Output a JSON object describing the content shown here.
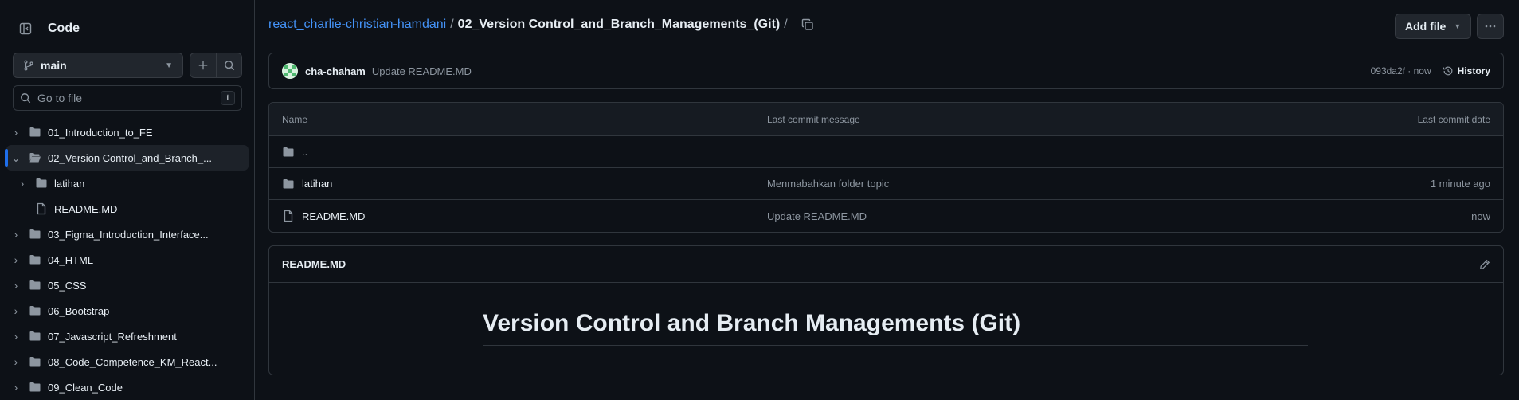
{
  "colors": {
    "background": "#0d1117",
    "border": "#30363d",
    "link": "#4493f8",
    "muted": "#8d96a0",
    "active_indicator": "#1f6feb",
    "top_accent": "#f78166"
  },
  "sidebar": {
    "title": "Code",
    "branch": "main",
    "goto_placeholder": "Go to file",
    "goto_shortcut": "t",
    "items": [
      {
        "label": "01_Introduction_to_FE",
        "type": "folder",
        "expanded": false,
        "depth": 0
      },
      {
        "label": "02_Version Control_and_Branch_...",
        "type": "folder",
        "expanded": true,
        "depth": 0,
        "active": true
      },
      {
        "label": "latihan",
        "type": "folder",
        "expanded": false,
        "depth": 1
      },
      {
        "label": "README.MD",
        "type": "file",
        "depth": 1
      },
      {
        "label": "03_Figma_Introduction_Interface...",
        "type": "folder",
        "expanded": false,
        "depth": 0
      },
      {
        "label": "04_HTML",
        "type": "folder",
        "expanded": false,
        "depth": 0
      },
      {
        "label": "05_CSS",
        "type": "folder",
        "expanded": false,
        "depth": 0
      },
      {
        "label": "06_Bootstrap",
        "type": "folder",
        "expanded": false,
        "depth": 0
      },
      {
        "label": "07_Javascript_Refreshment",
        "type": "folder",
        "expanded": false,
        "depth": 0
      },
      {
        "label": "08_Code_Competence_KM_React...",
        "type": "folder",
        "expanded": false,
        "depth": 0
      },
      {
        "label": "09_Clean_Code",
        "type": "folder",
        "expanded": false,
        "depth": 0
      }
    ]
  },
  "header": {
    "repo_link": "react_charlie-christian-hamdani",
    "separator": "/",
    "current_folder": "02_Version Control_and_Branch_Managements_(Git)",
    "trailing_separator": "/",
    "add_file_label": "Add file"
  },
  "commit": {
    "author": "cha-chaham",
    "message": "Update README.MD",
    "meta": "093da2f · now",
    "history_label": "History"
  },
  "files": {
    "headers": {
      "name": "Name",
      "message": "Last commit message",
      "date": "Last commit date"
    },
    "rows": [
      {
        "name": "..",
        "type": "parent",
        "message": "",
        "date": ""
      },
      {
        "name": "latihan",
        "type": "folder",
        "message": "Menmabahkan folder topic",
        "date": "1 minute ago"
      },
      {
        "name": "README.MD",
        "type": "file",
        "message": "Update README.MD",
        "date": "now"
      }
    ]
  },
  "readme": {
    "title": "README.MD",
    "heading": "Version Control and Branch Managements (Git)"
  }
}
